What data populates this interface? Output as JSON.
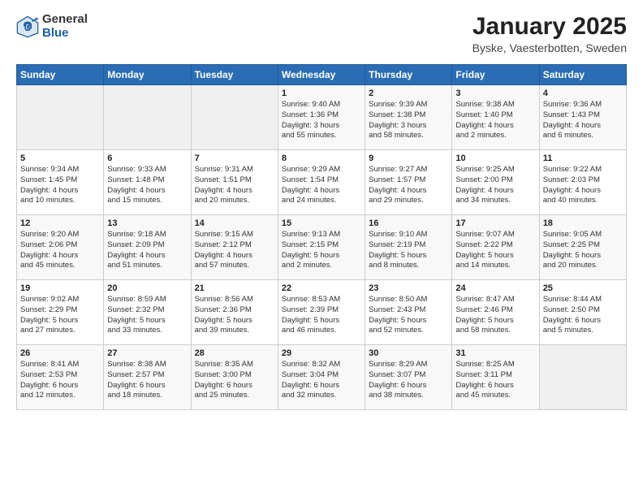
{
  "header": {
    "logo_general": "General",
    "logo_blue": "Blue",
    "title": "January 2025",
    "subtitle": "Byske, Vaesterbotten, Sweden"
  },
  "days_of_week": [
    "Sunday",
    "Monday",
    "Tuesday",
    "Wednesday",
    "Thursday",
    "Friday",
    "Saturday"
  ],
  "weeks": [
    [
      {
        "day": "",
        "info": ""
      },
      {
        "day": "",
        "info": ""
      },
      {
        "day": "",
        "info": ""
      },
      {
        "day": "1",
        "info": "Sunrise: 9:40 AM\nSunset: 1:36 PM\nDaylight: 3 hours\nand 55 minutes."
      },
      {
        "day": "2",
        "info": "Sunrise: 9:39 AM\nSunset: 1:38 PM\nDaylight: 3 hours\nand 58 minutes."
      },
      {
        "day": "3",
        "info": "Sunrise: 9:38 AM\nSunset: 1:40 PM\nDaylight: 4 hours\nand 2 minutes."
      },
      {
        "day": "4",
        "info": "Sunrise: 9:36 AM\nSunset: 1:43 PM\nDaylight: 4 hours\nand 6 minutes."
      }
    ],
    [
      {
        "day": "5",
        "info": "Sunrise: 9:34 AM\nSunset: 1:45 PM\nDaylight: 4 hours\nand 10 minutes."
      },
      {
        "day": "6",
        "info": "Sunrise: 9:33 AM\nSunset: 1:48 PM\nDaylight: 4 hours\nand 15 minutes."
      },
      {
        "day": "7",
        "info": "Sunrise: 9:31 AM\nSunset: 1:51 PM\nDaylight: 4 hours\nand 20 minutes."
      },
      {
        "day": "8",
        "info": "Sunrise: 9:29 AM\nSunset: 1:54 PM\nDaylight: 4 hours\nand 24 minutes."
      },
      {
        "day": "9",
        "info": "Sunrise: 9:27 AM\nSunset: 1:57 PM\nDaylight: 4 hours\nand 29 minutes."
      },
      {
        "day": "10",
        "info": "Sunrise: 9:25 AM\nSunset: 2:00 PM\nDaylight: 4 hours\nand 34 minutes."
      },
      {
        "day": "11",
        "info": "Sunrise: 9:22 AM\nSunset: 2:03 PM\nDaylight: 4 hours\nand 40 minutes."
      }
    ],
    [
      {
        "day": "12",
        "info": "Sunrise: 9:20 AM\nSunset: 2:06 PM\nDaylight: 4 hours\nand 45 minutes."
      },
      {
        "day": "13",
        "info": "Sunrise: 9:18 AM\nSunset: 2:09 PM\nDaylight: 4 hours\nand 51 minutes."
      },
      {
        "day": "14",
        "info": "Sunrise: 9:15 AM\nSunset: 2:12 PM\nDaylight: 4 hours\nand 57 minutes."
      },
      {
        "day": "15",
        "info": "Sunrise: 9:13 AM\nSunset: 2:15 PM\nDaylight: 5 hours\nand 2 minutes."
      },
      {
        "day": "16",
        "info": "Sunrise: 9:10 AM\nSunset: 2:19 PM\nDaylight: 5 hours\nand 8 minutes."
      },
      {
        "day": "17",
        "info": "Sunrise: 9:07 AM\nSunset: 2:22 PM\nDaylight: 5 hours\nand 14 minutes."
      },
      {
        "day": "18",
        "info": "Sunrise: 9:05 AM\nSunset: 2:25 PM\nDaylight: 5 hours\nand 20 minutes."
      }
    ],
    [
      {
        "day": "19",
        "info": "Sunrise: 9:02 AM\nSunset: 2:29 PM\nDaylight: 5 hours\nand 27 minutes."
      },
      {
        "day": "20",
        "info": "Sunrise: 8:59 AM\nSunset: 2:32 PM\nDaylight: 5 hours\nand 33 minutes."
      },
      {
        "day": "21",
        "info": "Sunrise: 8:56 AM\nSunset: 2:36 PM\nDaylight: 5 hours\nand 39 minutes."
      },
      {
        "day": "22",
        "info": "Sunrise: 8:53 AM\nSunset: 2:39 PM\nDaylight: 5 hours\nand 46 minutes."
      },
      {
        "day": "23",
        "info": "Sunrise: 8:50 AM\nSunset: 2:43 PM\nDaylight: 5 hours\nand 52 minutes."
      },
      {
        "day": "24",
        "info": "Sunrise: 8:47 AM\nSunset: 2:46 PM\nDaylight: 5 hours\nand 58 minutes."
      },
      {
        "day": "25",
        "info": "Sunrise: 8:44 AM\nSunset: 2:50 PM\nDaylight: 6 hours\nand 5 minutes."
      }
    ],
    [
      {
        "day": "26",
        "info": "Sunrise: 8:41 AM\nSunset: 2:53 PM\nDaylight: 6 hours\nand 12 minutes."
      },
      {
        "day": "27",
        "info": "Sunrise: 8:38 AM\nSunset: 2:57 PM\nDaylight: 6 hours\nand 18 minutes."
      },
      {
        "day": "28",
        "info": "Sunrise: 8:35 AM\nSunset: 3:00 PM\nDaylight: 6 hours\nand 25 minutes."
      },
      {
        "day": "29",
        "info": "Sunrise: 8:32 AM\nSunset: 3:04 PM\nDaylight: 6 hours\nand 32 minutes."
      },
      {
        "day": "30",
        "info": "Sunrise: 8:29 AM\nSunset: 3:07 PM\nDaylight: 6 hours\nand 38 minutes."
      },
      {
        "day": "31",
        "info": "Sunrise: 8:25 AM\nSunset: 3:11 PM\nDaylight: 6 hours\nand 45 minutes."
      },
      {
        "day": "",
        "info": ""
      }
    ]
  ]
}
